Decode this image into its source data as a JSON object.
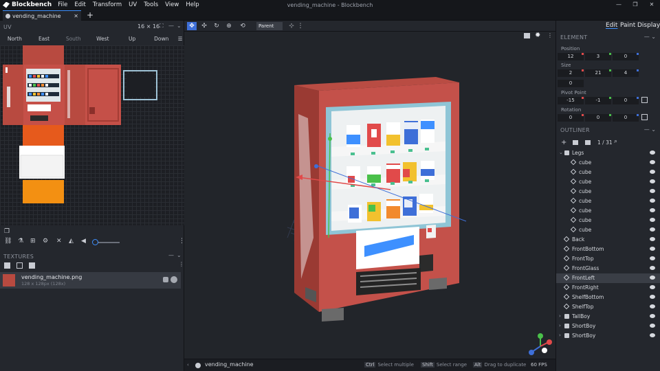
{
  "app": {
    "name": "Blockbench",
    "window_title": "vending_machine - Blockbench",
    "menu": [
      "File",
      "Edit",
      "Transform",
      "UV",
      "Tools",
      "View",
      "Help"
    ]
  },
  "tabs": [
    {
      "label": "vending_machine"
    }
  ],
  "uv": {
    "title": "UV",
    "size": "16 × 16",
    "faces": [
      "North",
      "East",
      "South",
      "West",
      "Up",
      "Down"
    ],
    "active_faces": [
      "North",
      "East",
      "West",
      "Up",
      "Down"
    ]
  },
  "textures": {
    "title": "TEXTURES",
    "items": [
      {
        "name": "vending_machine.png",
        "meta": "128 x 128px (128x)"
      }
    ]
  },
  "viewport_toolbar": {
    "pivot_mode": "Parent"
  },
  "status": {
    "project": "vending_machine",
    "hints": [
      {
        "key": "Ctrl",
        "text": "Select multiple"
      },
      {
        "key": "Shift",
        "text": "Select range"
      },
      {
        "key": "Alt",
        "text": "Drag to duplicate"
      }
    ],
    "fps": "60 FPS"
  },
  "modes": [
    "Edit",
    "Paint",
    "Display"
  ],
  "element": {
    "title": "ELEMENT",
    "position_label": "Position",
    "position": [
      "12",
      "3",
      "0"
    ],
    "size_label": "Size",
    "size": [
      "2",
      "21",
      "4"
    ],
    "inflate": "0",
    "pivot_label": "Pivot Point",
    "pivot": [
      "-15",
      "-1",
      "0"
    ],
    "rotation_label": "Rotation",
    "rotation": [
      "0",
      "0",
      "0"
    ]
  },
  "outliner": {
    "title": "OUTLINER",
    "count": "1 / 31",
    "items": [
      {
        "name": "Legs",
        "type": "group",
        "expanded": true,
        "depth": 0
      },
      {
        "name": "cube",
        "type": "cube",
        "depth": 1
      },
      {
        "name": "cube",
        "type": "cube",
        "depth": 1
      },
      {
        "name": "cube",
        "type": "cube",
        "depth": 1
      },
      {
        "name": "cube",
        "type": "cube",
        "depth": 1
      },
      {
        "name": "cube",
        "type": "cube",
        "depth": 1
      },
      {
        "name": "cube",
        "type": "cube",
        "depth": 1
      },
      {
        "name": "cube",
        "type": "cube",
        "depth": 1
      },
      {
        "name": "cube",
        "type": "cube",
        "depth": 1
      },
      {
        "name": "Back",
        "type": "cube",
        "depth": 0
      },
      {
        "name": "FrontBottom",
        "type": "cube",
        "depth": 0
      },
      {
        "name": "FrontTop",
        "type": "cube",
        "depth": 0
      },
      {
        "name": "FrontGlass",
        "type": "cube",
        "depth": 0
      },
      {
        "name": "FrontLeft",
        "type": "cube",
        "depth": 0,
        "selected": true
      },
      {
        "name": "FrontRight",
        "type": "cube",
        "depth": 0
      },
      {
        "name": "ShelfBottom",
        "type": "cube",
        "depth": 0
      },
      {
        "name": "ShelfTop",
        "type": "cube",
        "depth": 0
      },
      {
        "name": "TallBoy",
        "type": "group",
        "expanded": false,
        "depth": 0
      },
      {
        "name": "ShortBoy",
        "type": "group",
        "expanded": false,
        "depth": 0
      },
      {
        "name": "ShortBoy",
        "type": "group",
        "expanded": false,
        "depth": 0
      }
    ]
  },
  "colors": {
    "accent": "#3e90ff",
    "machine_red": "#b84a40",
    "axis_x": "#e14a4a",
    "axis_y": "#4ac04a",
    "axis_z": "#3e6fd8"
  },
  "icons": [
    "vending-machine-icon",
    "plus-icon",
    "search-icon",
    "eye-icon",
    "folder-icon",
    "cube-icon",
    "gizmo-icon"
  ]
}
